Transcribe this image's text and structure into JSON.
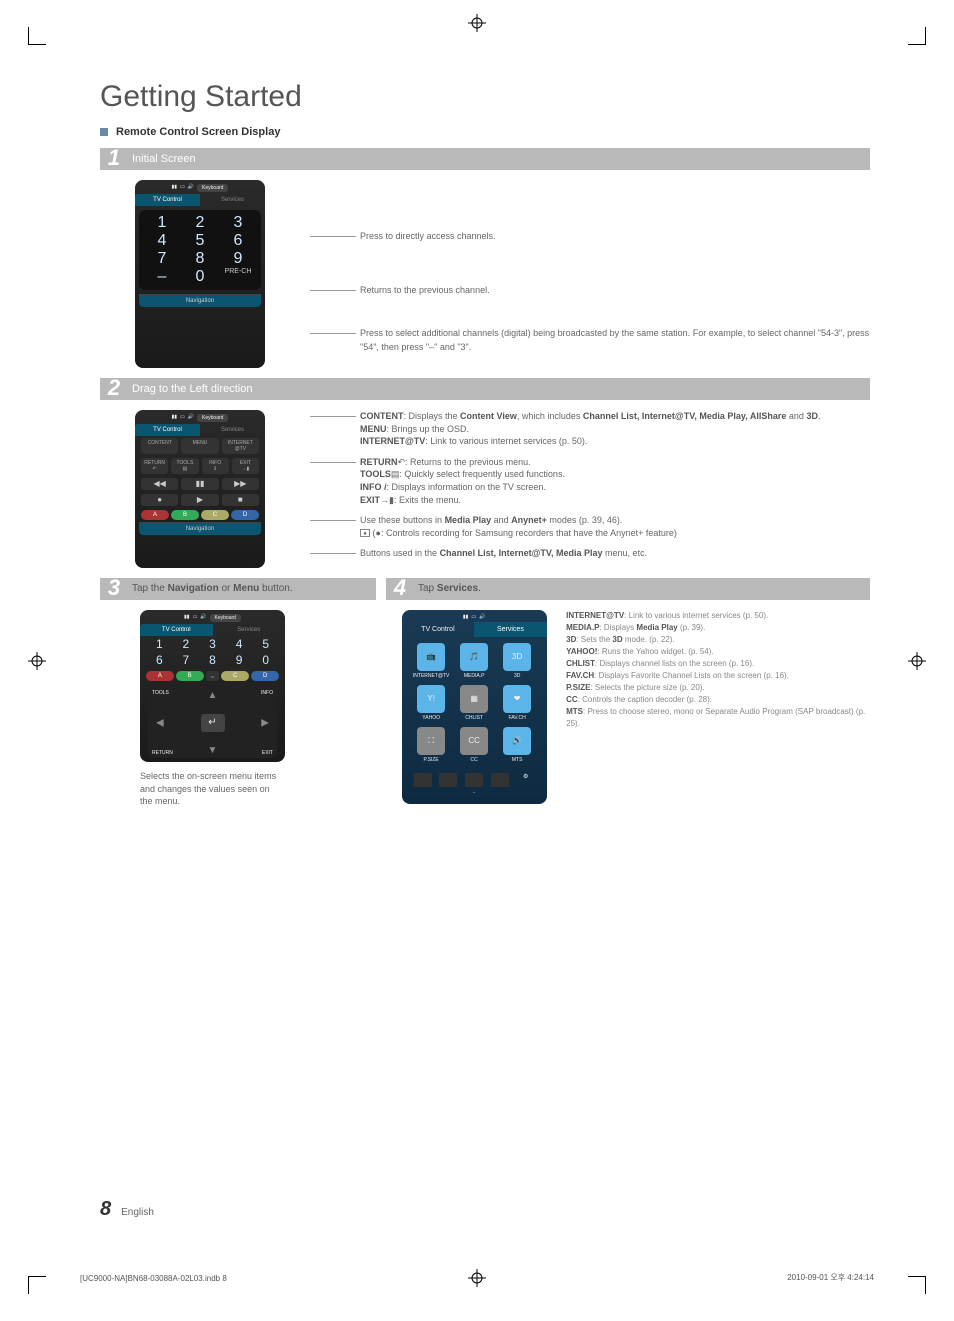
{
  "page_title": "Getting Started",
  "section_title": "Remote Control Screen Display",
  "page_number": "8",
  "language": "English",
  "footer_left": "[UC9000-NA]BN68-03088A-02L03.indb   8",
  "footer_right": "2010-09-01   오후 4:24:14",
  "step1": {
    "num": "1",
    "title": "Initial Screen",
    "remote": {
      "keyboard": "Keyboard",
      "tab_tv": "TV Control",
      "tab_services": "Services",
      "digits": [
        "1",
        "2",
        "3",
        "4",
        "5",
        "6",
        "7",
        "8",
        "9",
        "–",
        "0"
      ],
      "pre_ch": "PRE-CH",
      "nav": "Navigation"
    },
    "co1": "Press to directly access channels.",
    "co2": "Returns to the previous channel.",
    "co3": "Press to select additional channels (digital) being broadcasted by the same station. For example, to select channel \"54-3\", press \"54\", then press \"–\" and \"3\"."
  },
  "step2": {
    "num": "2",
    "title": "Drag to the Left direction",
    "remote": {
      "keyboard": "Keyboard",
      "tab_tv": "TV Control",
      "tab_services": "Services",
      "btn_content": "CONTENT",
      "btn_menu": "MENU",
      "btn_internet": "INTERNET @TV",
      "btn_return": "RETURN",
      "btn_tools": "TOOLS",
      "btn_info": "INFO",
      "btn_exit": "EXIT",
      "btn_a": "A",
      "btn_b": "B",
      "btn_c": "C",
      "btn_d": "D",
      "nav": "Navigation"
    },
    "co1_pre": "CONTENT",
    "co1a": ": Displays the ",
    "co1_b1": "Content View",
    "co1b": ", which includes ",
    "co1_b2": "Channel List, Internet@TV, Media Play, AllShare",
    "co1c": " and ",
    "co1_b3": "3D",
    "co1d": ".",
    "co2_pre": "MENU",
    "co2": ": Brings up the OSD.",
    "co3_pre": "INTERNET@TV",
    "co3": ": Link to various internet services (p. 50).",
    "co4_pre": "RETURN",
    "co4": ": Returns to the previous menu.",
    "co5_pre": "TOOLS",
    "co5": ": Quickly select frequently used functions.",
    "co6_pre": "INFO",
    "co6": ": Displays information on the TV screen.",
    "co7_pre": "EXIT",
    "co7": ": Exits the menu.",
    "co8a": "Use these buttons in ",
    "co8_b1": "Media Play",
    "co8b": " and ",
    "co8_b2": "Anynet+",
    "co8c": " modes (p. 39, 46).",
    "co8d": "(●: Controls recording for Samsung recorders that have the Anynet+ feature)",
    "co9a": "Buttons used in the ",
    "co9_b": "Channel List, Internet@TV, Media Play",
    "co9b": " menu, etc."
  },
  "step3": {
    "num": "3",
    "title_a": "Tap the ",
    "title_b1": "Navigation",
    "title_mid": " or ",
    "title_b2": "Menu",
    "title_c": " button.",
    "remote": {
      "keyboard": "Keyboard",
      "tab_tv": "TV Control",
      "tab_services": "Services",
      "digits": [
        "1",
        "2",
        "3",
        "4",
        "5",
        "6",
        "7",
        "8",
        "9",
        "0"
      ],
      "btn_a": "A",
      "btn_b": "B",
      "btn_c": "C",
      "btn_d": "D",
      "tools": "TOOLS",
      "info": "INFO",
      "return": "RETURN",
      "exit": "EXIT"
    },
    "caption": "Selects the on-screen menu items and changes the values seen on the menu."
  },
  "step4": {
    "num": "4",
    "title_a": "Tap ",
    "title_b": "Services",
    "title_c": ".",
    "remote": {
      "tab_tv": "TV Control",
      "tab_services": "Services",
      "s1": "INTERNET@TV",
      "s2": "MEDIA.P",
      "s3": "3D",
      "s4": "YAHOO",
      "s5": "CHLIST",
      "s6": "FAV.CH",
      "s7": "P.SIZE",
      "s8": "CC",
      "s9": "MTS"
    },
    "c1_pre": "INTERNET@TV",
    "c1": ": Link to various internet services (p. 50).",
    "c2_pre": "MEDIA.P",
    "c2a": ": Displays ",
    "c2_b": "Media Play",
    "c2b": " (p. 39).",
    "c3_pre": "3D",
    "c3a": ": Sets the ",
    "c3_b": "3D",
    "c3b": " mode. (p. 22).",
    "c4_pre": "YAHOO!",
    "c4": ": Runs the Yahoo widget. (p. 54).",
    "c5_pre": "CHLIST",
    "c5": ": Displays channel lists on the screen (p. 16).",
    "c6_pre": "FAV.CH",
    "c6": ": Displays Favorite Channel Lists on the screen (p. 16).",
    "c7_pre": "P.SIZE",
    "c7": ": Selects the picture size (p. 20).",
    "c8_pre": "CC",
    "c8": ": Controls the caption decoder (p. 28).",
    "c9_pre": "MTS",
    "c9": ": Press to choose stereo, mono or Separate Audio Program (SAP broadcast) (p. 25)."
  }
}
